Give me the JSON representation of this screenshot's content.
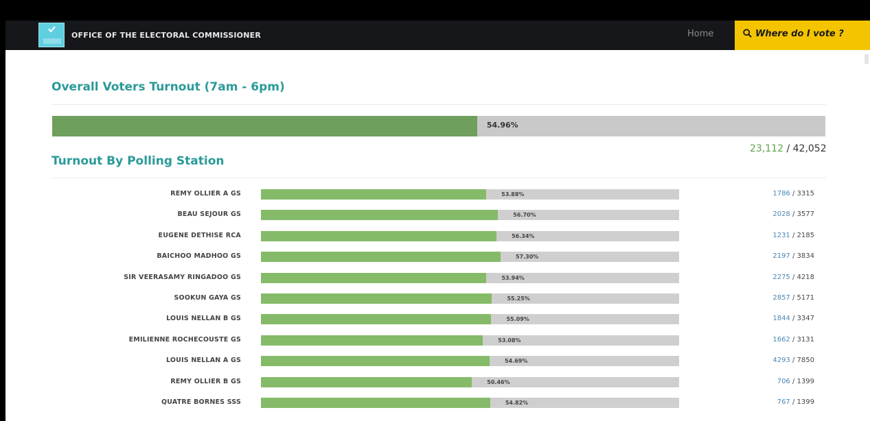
{
  "navbar": {
    "brand": "OFFICE OF THE ELECTORAL COMMISSIONER",
    "home_label": "Home",
    "where_label": "Where do I vote ?"
  },
  "overall": {
    "heading": "Overall Voters Turnout (7am - 6pm)",
    "percent_label": "54.96%",
    "percent": 54.96,
    "voted": "23,112",
    "separator": "/",
    "registered": "42,052"
  },
  "stations": {
    "heading": "Turnout By Polling Station",
    "rows": [
      {
        "name": "REMY OLLIER A GS",
        "pct_label": "53.88%",
        "pct": 53.88,
        "voted": "1786",
        "sep": "/",
        "total": "3315"
      },
      {
        "name": "BEAU SEJOUR GS",
        "pct_label": "56.70%",
        "pct": 56.7,
        "voted": "2028",
        "sep": "/",
        "total": "3577"
      },
      {
        "name": "EUGENE DETHISE RCA",
        "pct_label": "56.34%",
        "pct": 56.34,
        "voted": "1231",
        "sep": "/",
        "total": "2185"
      },
      {
        "name": "BAICHOO MADHOO GS",
        "pct_label": "57.30%",
        "pct": 57.3,
        "voted": "2197",
        "sep": "/",
        "total": "3834"
      },
      {
        "name": "SIR VEERASAMY RINGADOO GS",
        "pct_label": "53.94%",
        "pct": 53.94,
        "voted": "2275",
        "sep": "/",
        "total": "4218"
      },
      {
        "name": "SOOKUN GAYA GS",
        "pct_label": "55.25%",
        "pct": 55.25,
        "voted": "2857",
        "sep": "/",
        "total": "5171"
      },
      {
        "name": "LOUIS NELLAN B GS",
        "pct_label": "55.09%",
        "pct": 55.09,
        "voted": "1844",
        "sep": "/",
        "total": "3347"
      },
      {
        "name": "EMILIENNE ROCHECOUSTE GS",
        "pct_label": "53.08%",
        "pct": 53.08,
        "voted": "1662",
        "sep": "/",
        "total": "3131"
      },
      {
        "name": "LOUIS NELLAN A GS",
        "pct_label": "54.69%",
        "pct": 54.69,
        "voted": "4293",
        "sep": "/",
        "total": "7850"
      },
      {
        "name": "REMY OLLIER B GS",
        "pct_label": "50.46%",
        "pct": 50.46,
        "voted": "706",
        "sep": "/",
        "total": "1399"
      },
      {
        "name": "QUATRE BORNES SSS",
        "pct_label": "54.82%",
        "pct": 54.82,
        "voted": "767",
        "sep": "/",
        "total": "1399"
      }
    ]
  },
  "colors": {
    "accent": "#2a9a98",
    "bar_fill": "#85bb68",
    "overall_fill": "#6f9f5c",
    "bar_track": "#cfcfcf",
    "button": "#f4c400",
    "count_link": "#4a86b4"
  },
  "icons": {
    "logo": "ballot-check-icon",
    "where": "search-icon"
  }
}
